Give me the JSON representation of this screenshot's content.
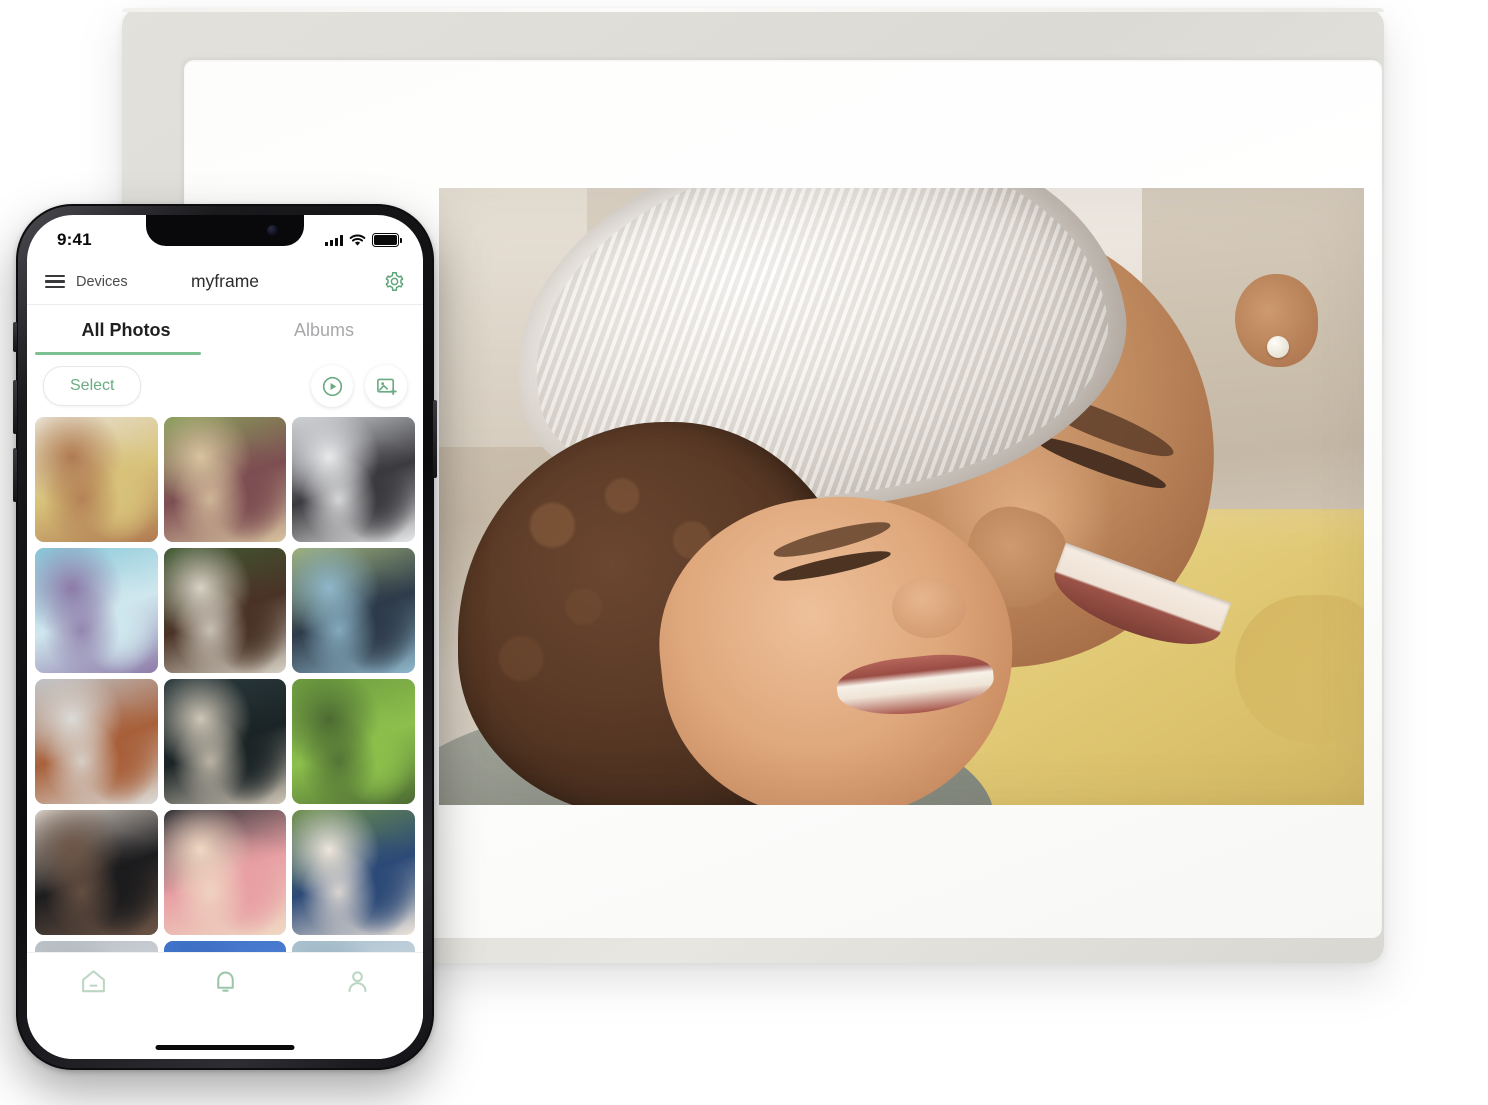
{
  "device_frame": {
    "name": "digital-photo-frame",
    "bezel_color": "#dedcd6",
    "mat_color": "#ffffff",
    "displayed_photo": {
      "alt": "Grandmother in yellow top nuzzling a smiling young boy",
      "skin": "#c08a5f",
      "hair": "#f1efec",
      "top_color": "#e3cc7a",
      "child_hair": "#5a3a26",
      "child_shirt": "#8e9287",
      "background": "#cfc3b2"
    }
  },
  "phone": {
    "status_bar": {
      "time": "9:41",
      "cellular_icon": "signal-bars-icon",
      "wifi_icon": "wifi-icon",
      "battery_icon": "battery-full-icon"
    },
    "header": {
      "menu_icon": "hamburger-menu-icon",
      "devices_label": "Devices",
      "title": "myframe",
      "settings_icon": "gear-icon",
      "accent_color": "#6aab82"
    },
    "tabs": [
      {
        "label": "All Photos",
        "active": true
      },
      {
        "label": "Albums",
        "active": false
      }
    ],
    "action_bar": {
      "select_label": "Select",
      "play_icon": "play-circle-icon",
      "add_photo_icon": "add-photo-icon"
    },
    "photo_grid": [
      {
        "alt": "Grandmother hugging young boy",
        "c1": "#e8e1d6",
        "c2": "#d8c27a",
        "c3": "#b07a52",
        "style": "portrait-warm"
      },
      {
        "alt": "Two children hugging in plaid blanket outdoors",
        "c1": "#8aa05c",
        "c2": "#7d4e52",
        "c3": "#d9c3a0",
        "style": "outdoor-green"
      },
      {
        "alt": "Father holding baby on bed",
        "c1": "#cfd2d6",
        "c2": "#3b3a3e",
        "c3": "#e9eaec",
        "style": "indoor-gray"
      },
      {
        "alt": "Mother and daughter hugging on beach",
        "c1": "#86c7d8",
        "c2": "#cfe7ee",
        "c3": "#8d7aa8",
        "style": "beach-blue"
      },
      {
        "alt": "Two young brothers embracing by hedge",
        "c1": "#3f5a32",
        "c2": "#4a3326",
        "c3": "#d8d2c6",
        "style": "garden-dark"
      },
      {
        "alt": "Large family group photo outdoors",
        "c1": "#9fb27a",
        "c2": "#2e3b4a",
        "c3": "#8fb8cb",
        "style": "family-outdoor"
      },
      {
        "alt": "Three friends smiling by the river in a city",
        "c1": "#c0c4c8",
        "c2": "#a8603a",
        "c3": "#dcdcd8",
        "style": "city-gray"
      },
      {
        "alt": "Father with toddler on shoulders by dark door",
        "c1": "#2c3b3e",
        "c2": "#1b2426",
        "c3": "#cfc6b6",
        "style": "door-teal"
      },
      {
        "alt": "Girl in green coat blowing bubbles in park",
        "c1": "#6c9b3f",
        "c2": "#8cbf4c",
        "c3": "#4c6b33",
        "style": "park-green"
      },
      {
        "alt": "Woman holding an ultrasound scan photo",
        "c1": "#d8cfc6",
        "c2": "#1c1c1e",
        "c3": "#6d5546",
        "style": "ultrasound"
      },
      {
        "alt": "Twin girls in pink hugging",
        "c1": "#2a2d31",
        "c2": "#e8a0a4",
        "c3": "#f0d9c4",
        "style": "twins-pink"
      },
      {
        "alt": "Grandfather holding a toddler girl in the park",
        "c1": "#6d8f4a",
        "c2": "#2c4a77",
        "c3": "#efe6dc",
        "style": "grandpa-park"
      },
      {
        "alt": "Partially visible photo row",
        "c1": "#b9c0c6",
        "c2": "#cfd4d8",
        "c3": "#aab2b8",
        "style": "cut-gray"
      },
      {
        "alt": "Partially visible blue photo",
        "c1": "#3f72c8",
        "c2": "#4f80d4",
        "c3": "#3566bb",
        "style": "cut-blue"
      },
      {
        "alt": "Partially visible seaside photo",
        "c1": "#a8c0ce",
        "c2": "#cdd9e0",
        "c3": "#8fa9b8",
        "style": "cut-sea"
      }
    ],
    "tab_bar": [
      {
        "icon": "home-icon",
        "name": "home"
      },
      {
        "icon": "bell-icon",
        "name": "notifications"
      },
      {
        "icon": "person-icon",
        "name": "profile"
      }
    ],
    "home_indicator": "home-indicator"
  }
}
